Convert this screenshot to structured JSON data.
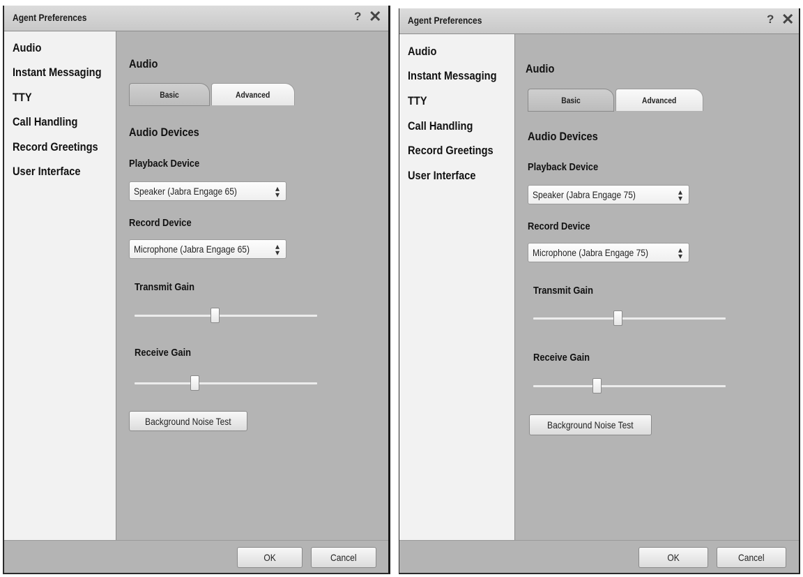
{
  "dialogs": [
    {
      "title": "Agent Preferences",
      "help_glyph": "?",
      "close_glyph": "✕",
      "sidebar": [
        "Audio",
        "Instant Messaging",
        "TTY",
        "Call Handling",
        "Record Greetings",
        "User Interface"
      ],
      "section_title": "Audio",
      "tabs": {
        "basic": "Basic",
        "advanced": "Advanced",
        "active": "Advanced"
      },
      "devices_heading": "Audio Devices",
      "playback_label": "Playback Device",
      "playback_value": "Speaker (Jabra Engage 65)",
      "record_label": "Record Device",
      "record_value": "Microphone (Jabra Engage 65)",
      "transmit_label": "Transmit Gain",
      "transmit_level": 0.44,
      "receive_label": "Receive Gain",
      "receive_level": 0.33,
      "noise_button": "Background Noise Test",
      "ok_label": "OK",
      "cancel_label": "Cancel"
    },
    {
      "title": "Agent Preferences",
      "help_glyph": "?",
      "close_glyph": "✕",
      "sidebar": [
        "Audio",
        "Instant Messaging",
        "TTY",
        "Call Handling",
        "Record Greetings",
        "User Interface"
      ],
      "section_title": "Audio",
      "tabs": {
        "basic": "Basic",
        "advanced": "Advanced",
        "active": "Advanced"
      },
      "devices_heading": "Audio Devices",
      "playback_label": "Playback Device",
      "playback_value": "Speaker (Jabra Engage 75)",
      "record_label": "Record Device",
      "record_value": "Microphone (Jabra Engage 75)",
      "transmit_label": "Transmit Gain",
      "transmit_level": 0.44,
      "receive_label": "Receive Gain",
      "receive_level": 0.33,
      "noise_button": "Background Noise Test",
      "ok_label": "OK",
      "cancel_label": "Cancel"
    }
  ],
  "colors": {
    "dialog_bg": "#b4b4b4",
    "sidebar_bg": "#f2f2f2",
    "titlebar_bg": "#d2d2d2"
  }
}
